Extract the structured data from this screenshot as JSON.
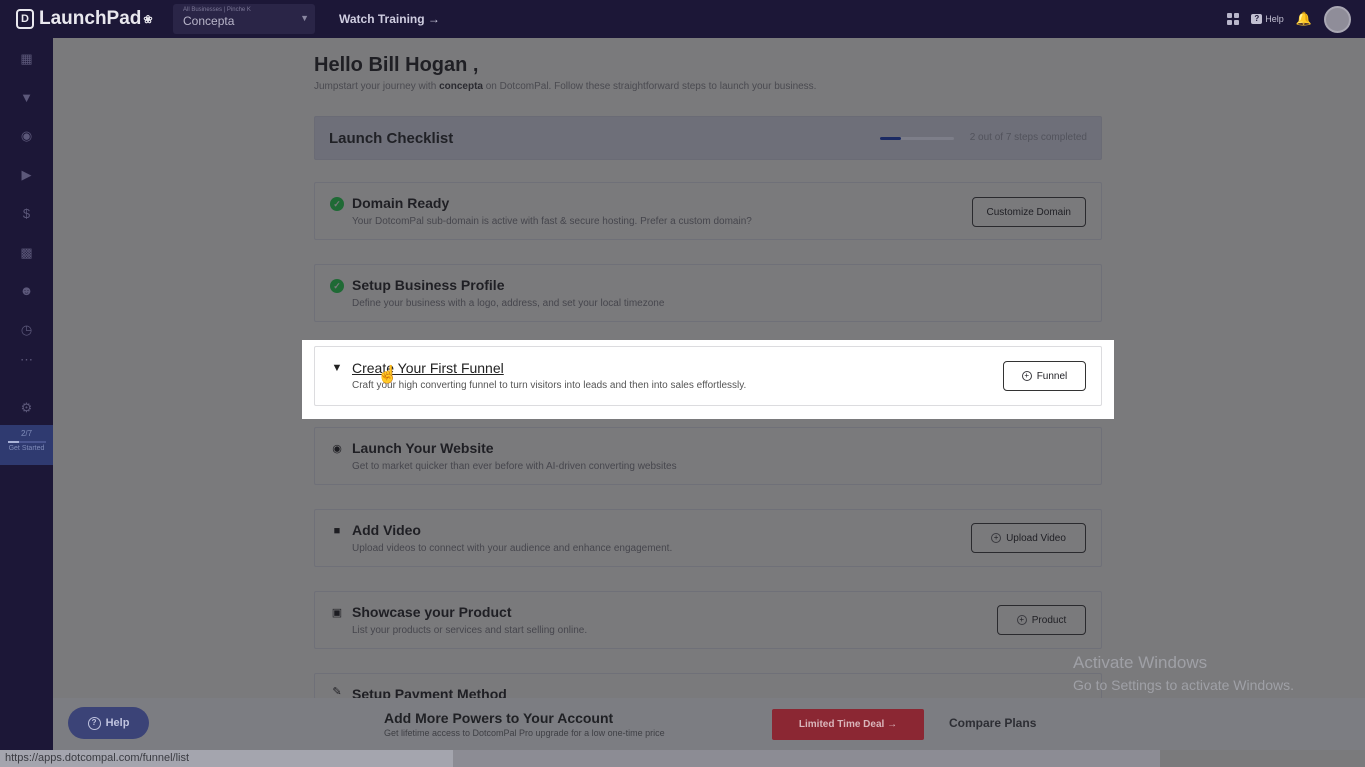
{
  "topbar": {
    "brand": "LaunchPad",
    "business_small": "All Businesses | Pinche K",
    "business_name": "Concepta",
    "watch_training": "Watch Training →",
    "help": "Help"
  },
  "sidebar": {
    "progress_fraction": "2/7",
    "get_started": "Get Started"
  },
  "main": {
    "greeting": "Hello Bill Hogan ,",
    "subtitle_pre": "Jumpstart your journey with ",
    "subtitle_bold": "concepta",
    "subtitle_post": " on DotcomPal. Follow these straightforward steps to launch your business.",
    "checklist": {
      "title": "Launch Checklist",
      "progress_text": "2 out of 7 steps completed",
      "progress": 0.2857
    },
    "items": [
      {
        "title": "Domain Ready",
        "desc": "Your DotcomPal sub-domain is active with fast & secure hosting. Prefer a custom domain?",
        "button": "Customize Domain",
        "done": true
      },
      {
        "title": "Setup Business Profile",
        "desc": "Define your business with a logo, address, and set your local timezone",
        "done": true
      },
      {
        "title": "Create Your First Funnel",
        "desc": "Craft your high converting funnel to turn visitors into leads and then into sales effortlessly.",
        "button": "Funnel",
        "done": false
      },
      {
        "title": "Launch Your Website",
        "desc": "Get to market quicker than ever before with AI-driven converting websites",
        "done": false
      },
      {
        "title": "Add Video",
        "desc": "Upload videos to connect with your audience and enhance engagement.",
        "button": "Upload Video",
        "done": false
      },
      {
        "title": "Showcase your Product",
        "desc": "List your products or services and start selling online.",
        "button": "Product",
        "done": false
      },
      {
        "title": "Setup Payment Method",
        "done": false
      }
    ]
  },
  "bottom": {
    "help": "Help",
    "promo_title": "Add More Powers to Your Account",
    "promo_sub": "Get lifetime access to DotcomPal Pro upgrade for a low one-time price",
    "deal": "Limited Time Deal →",
    "compare": "Compare Plans"
  },
  "watermark": {
    "line1": "Activate Windows",
    "line2": "Go to Settings to activate Windows."
  },
  "statusbar": {
    "url": "https://apps.dotcompal.com/funnel/list"
  }
}
